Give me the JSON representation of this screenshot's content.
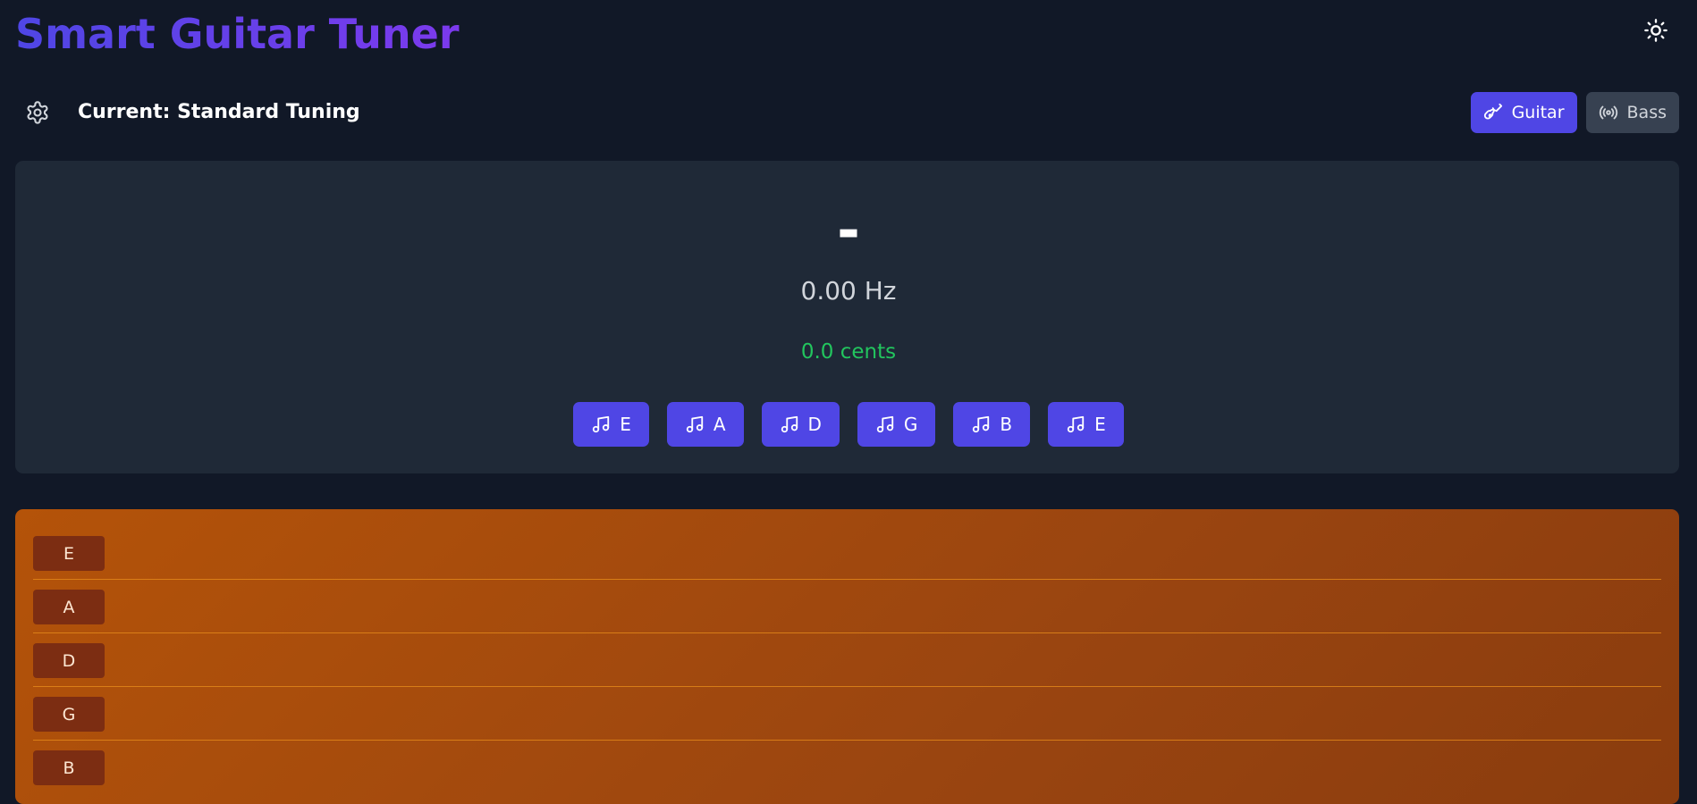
{
  "app": {
    "title": "Smart Guitar Tuner",
    "icons": {
      "theme": "sun-icon",
      "settings": "gear-icon",
      "guitar": "guitar-icon",
      "bass": "radio-waves-icon",
      "note": "music-notes-icon"
    }
  },
  "toolbar": {
    "current_tuning": "Current: Standard Tuning",
    "guitar_label": "Guitar",
    "bass_label": "Bass",
    "active_instrument": "Guitar"
  },
  "tuner": {
    "note": "-",
    "frequency": "0.00 Hz",
    "cents": "0.0 cents",
    "strings": [
      "E",
      "A",
      "D",
      "G",
      "B",
      "E"
    ]
  },
  "fretboard": {
    "strings": [
      "E",
      "A",
      "D",
      "G",
      "B"
    ]
  },
  "colors": {
    "background": "#111827",
    "panel": "#1f2937",
    "accent": "#4f46e5",
    "in_tune": "#22c55e",
    "fretboard": "#b45309"
  }
}
